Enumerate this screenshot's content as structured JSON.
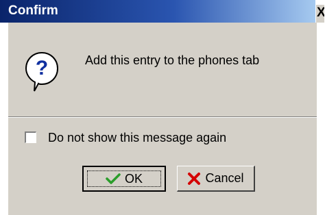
{
  "window": {
    "title": "Confirm",
    "close_glyph": "✕"
  },
  "message": {
    "icon": "question-icon",
    "text": "Add this entry to the phones tab"
  },
  "checkbox": {
    "label": "Do not show this message again",
    "checked": false
  },
  "buttons": {
    "ok_label": "OK",
    "ok_icon": "checkmark-icon",
    "cancel_label": "Cancel",
    "cancel_icon": "x-icon"
  },
  "colors": {
    "titlebar_start": "#0a246a",
    "titlebar_end": "#a6caf0",
    "face": "#d4d0c8",
    "check_green": "#2a9d2a",
    "cancel_red": "#d40000",
    "question_blue": "#1030a0"
  }
}
